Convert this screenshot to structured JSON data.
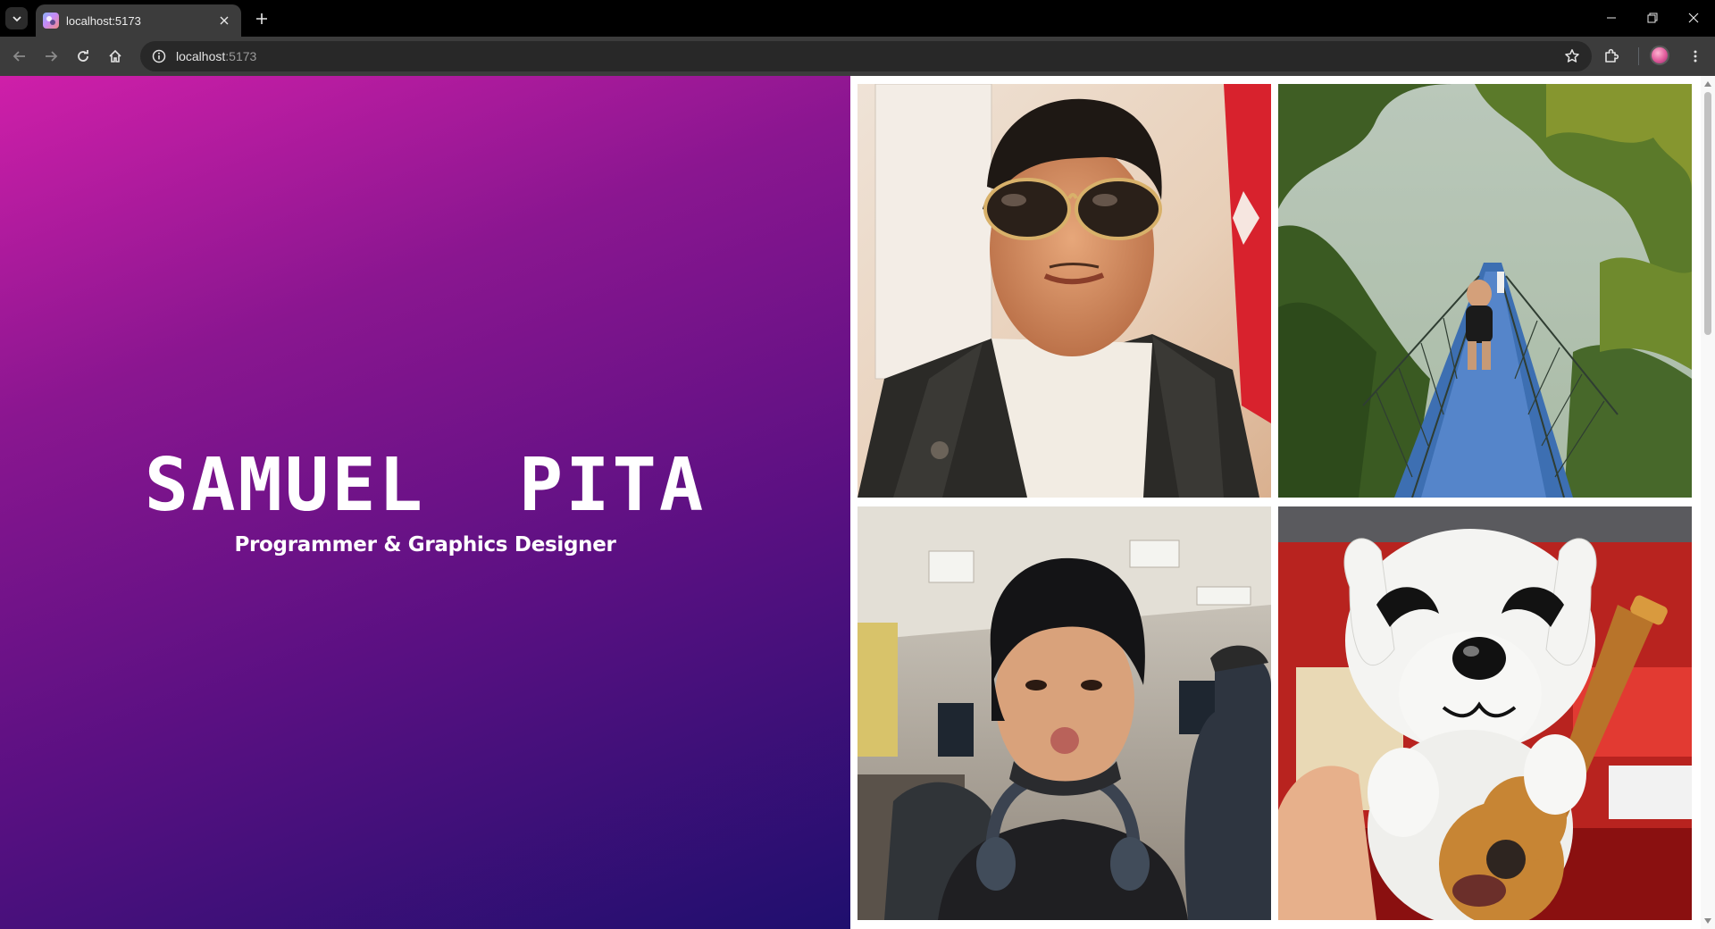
{
  "browser": {
    "tab_title": "localhost:5173",
    "url_host": "localhost",
    "url_port": ":5173",
    "icons": {
      "tab_list": "chevron-down-icon",
      "tab_close": "close-icon",
      "new_tab": "plus-icon",
      "back": "arrow-left-icon",
      "forward": "arrow-right-icon",
      "reload": "reload-icon",
      "home": "home-icon",
      "site_info": "info-icon",
      "bookmark": "star-icon",
      "extensions": "puzzle-icon",
      "menu": "kebab-menu-icon"
    }
  },
  "hero": {
    "name": "SAMUEL  PITA",
    "subtitle": "Programmer & Graphics Designer",
    "colors": {
      "gradient_start": "#cf1fa9",
      "gradient_end": "#1f0f6e"
    }
  },
  "gallery": {
    "photos": [
      {
        "subject": "selfie-sunglasses-leather-jacket"
      },
      {
        "subject": "suspension-bridge-forest"
      },
      {
        "subject": "selfie-classroom-headphones"
      },
      {
        "subject": "plush-dog-with-guitar"
      }
    ]
  }
}
